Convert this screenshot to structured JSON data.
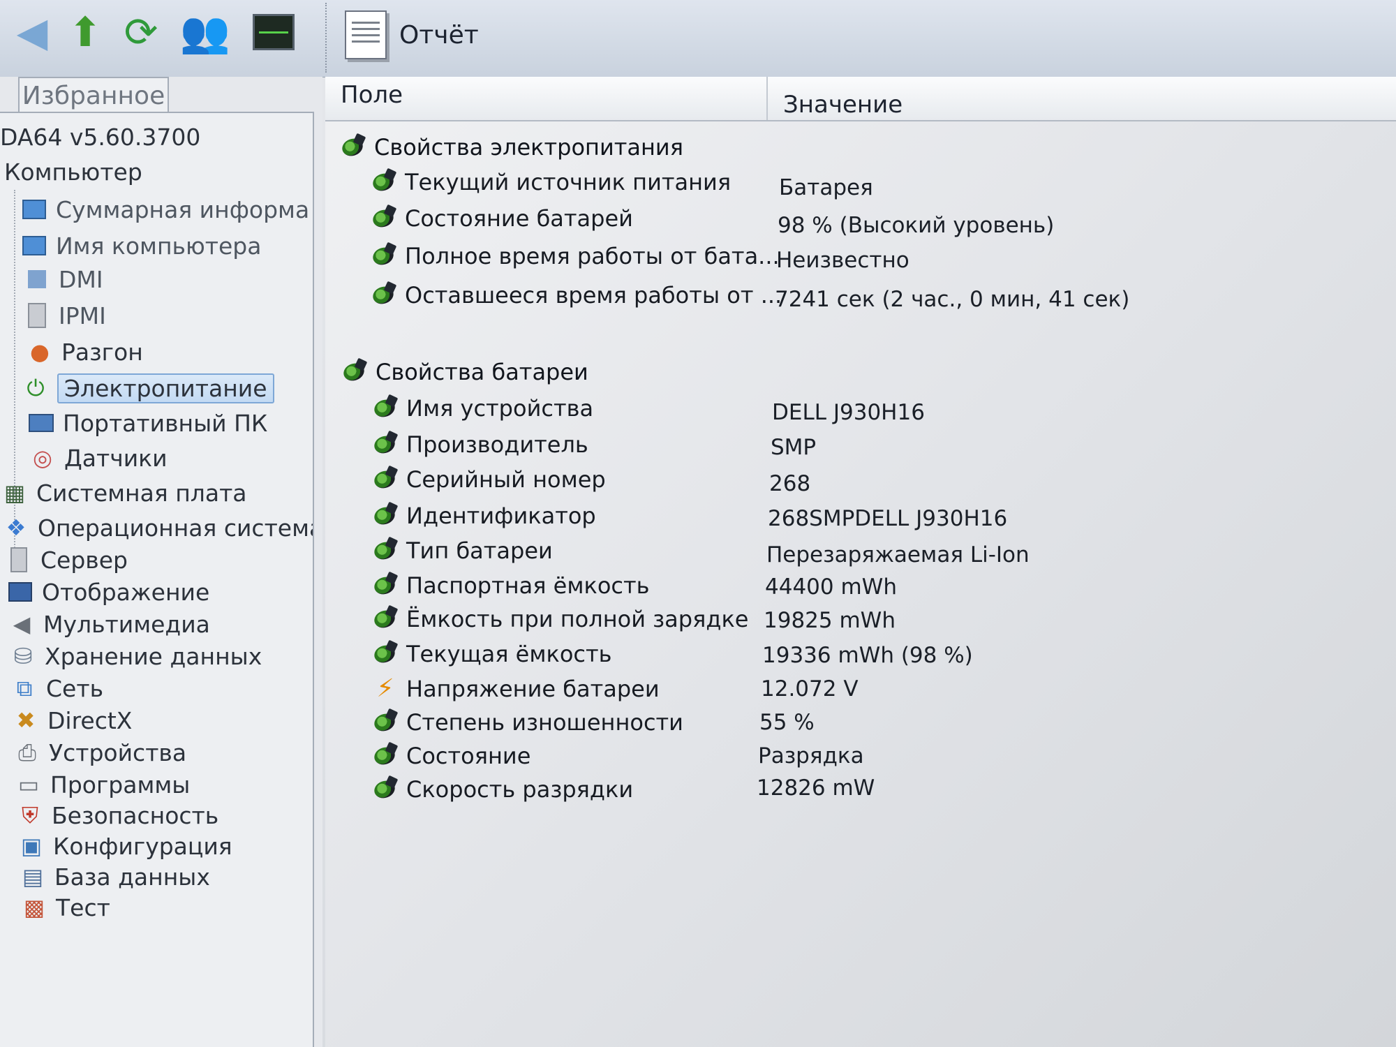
{
  "toolbar": {
    "report_label": "Отчёт"
  },
  "left_panel": {
    "tab_label": "Избранное",
    "root_label": "DA64 v5.60.3700",
    "items": [
      {
        "label": "Компьютер"
      },
      {
        "label": "Суммарная информа"
      },
      {
        "label": "Имя компьютера"
      },
      {
        "label": "DMI"
      },
      {
        "label": "IPMI"
      },
      {
        "label": "Разгон"
      },
      {
        "label": "Электропитание"
      },
      {
        "label": "Портативный ПК"
      },
      {
        "label": "Датчики"
      },
      {
        "label": "Системная плата"
      },
      {
        "label": "Операционная система"
      },
      {
        "label": "Сервер"
      },
      {
        "label": "Отображение"
      },
      {
        "label": "Мультимедиа"
      },
      {
        "label": "Хранение данных"
      },
      {
        "label": "Сеть"
      },
      {
        "label": "DirectX"
      },
      {
        "label": "Устройства"
      },
      {
        "label": "Программы"
      },
      {
        "label": "Безопасность"
      },
      {
        "label": "Конфигурация"
      },
      {
        "label": "База данных"
      },
      {
        "label": "Тест"
      }
    ]
  },
  "report": {
    "headers": {
      "field": "Поле",
      "value": "Значение"
    },
    "sections": [
      {
        "title": "Свойства электропитания",
        "rows": [
          {
            "field": "Текущий источник питания",
            "value": "Батарея"
          },
          {
            "field": "Состояние батарей",
            "value": "98 % (Высокий уровень)"
          },
          {
            "field": "Полное время работы от бата...",
            "value": "Неизвестно"
          },
          {
            "field": "Оставшееся время работы от ...",
            "value": "7241 сек (2 час., 0 мин, 41 сек)"
          }
        ]
      },
      {
        "title": "Свойства батареи",
        "rows": [
          {
            "field": "Имя устройства",
            "value": "DELL J930H16"
          },
          {
            "field": "Производитель",
            "value": "SMP"
          },
          {
            "field": "Серийный номер",
            "value": "268"
          },
          {
            "field": "Идентификатор",
            "value": "268SMPDELL J930H16"
          },
          {
            "field": "Тип батареи",
            "value": "Перезаряжаемая Li-Ion"
          },
          {
            "field": "Паспортная ёмкость",
            "value": "44400 mWh"
          },
          {
            "field": "Ёмкость при полной зарядке",
            "value": "19825 mWh"
          },
          {
            "field": "Текущая ёмкость",
            "value": "19336 mWh  (98 %)"
          },
          {
            "field": "Напряжение батареи",
            "value": "12.072 V"
          },
          {
            "field": "Степень изношенности",
            "value": "55 %"
          },
          {
            "field": "Состояние",
            "value": "Разрядка"
          },
          {
            "field": "Скорость разрядки",
            "value": "12826 mW"
          }
        ]
      }
    ]
  }
}
